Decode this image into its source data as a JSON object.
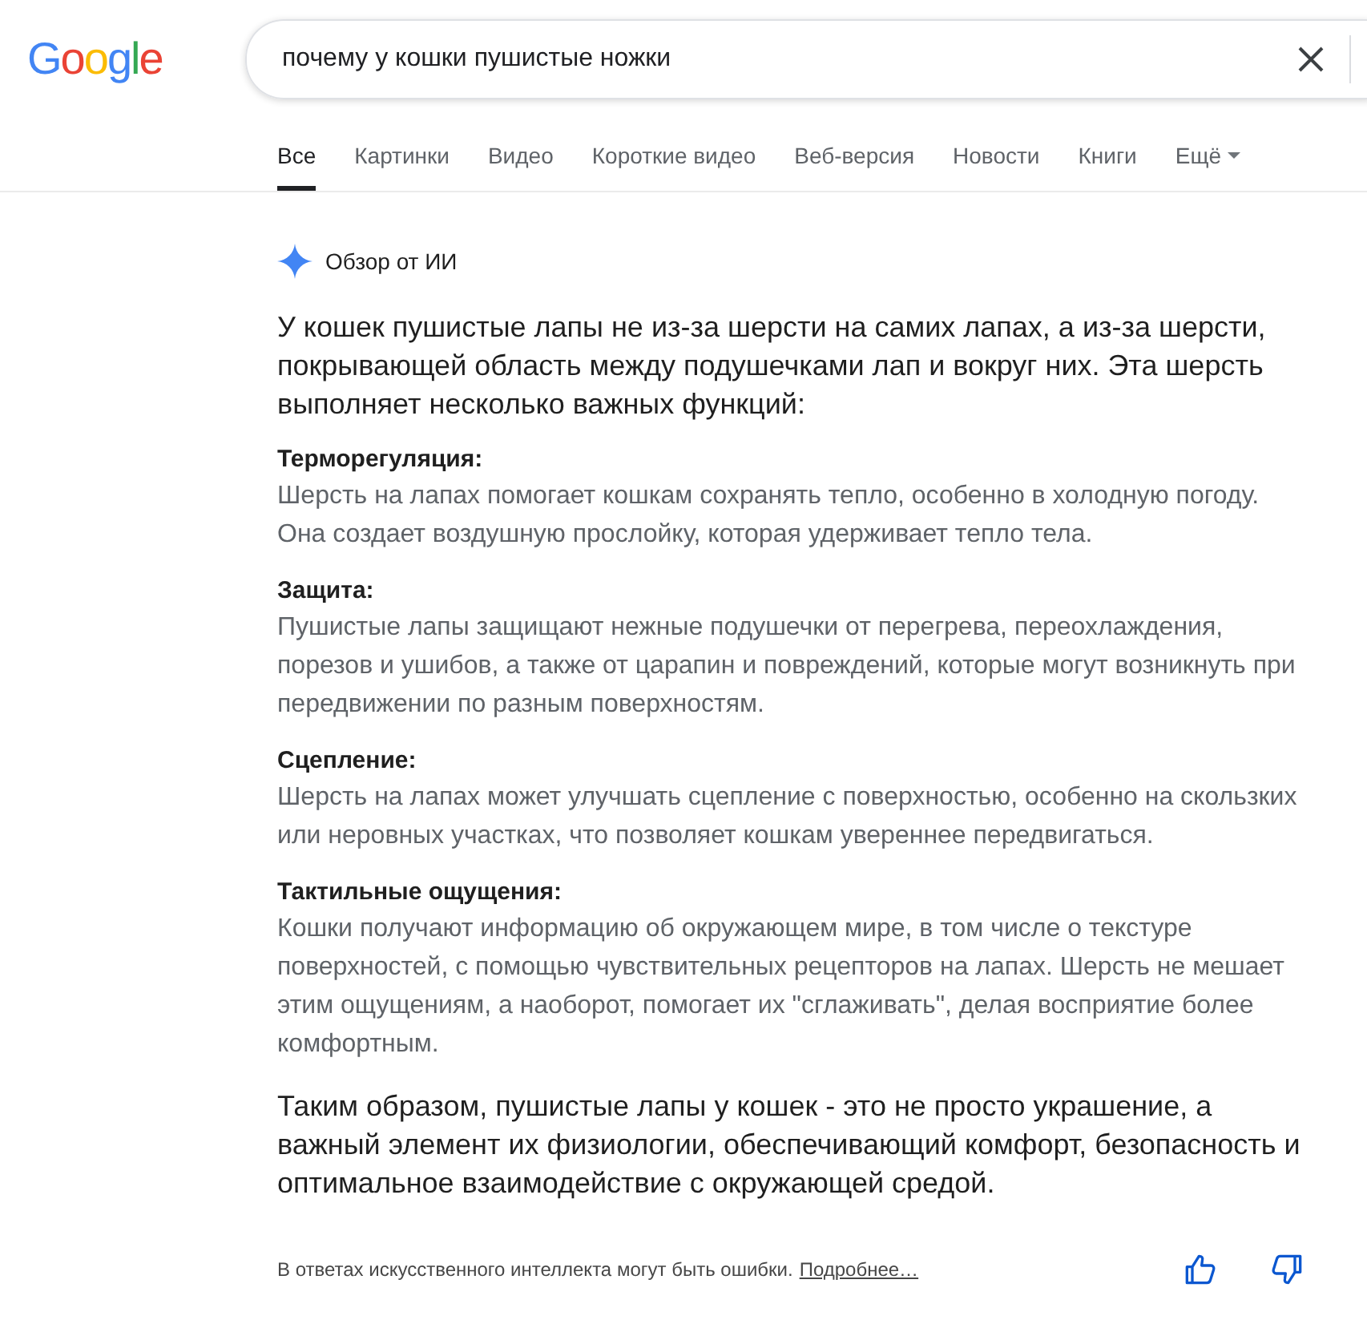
{
  "logo": "Google",
  "search": {
    "value": "почему у кошки пушистые ножки"
  },
  "tabs": [
    {
      "label": "Все",
      "selected": true
    },
    {
      "label": "Картинки",
      "selected": false
    },
    {
      "label": "Видео",
      "selected": false
    },
    {
      "label": "Короткие видео",
      "selected": false
    },
    {
      "label": "Веб-версия",
      "selected": false
    },
    {
      "label": "Новости",
      "selected": false
    },
    {
      "label": "Книги",
      "selected": false
    },
    {
      "label": "Ещё",
      "selected": false,
      "dropdown": true
    }
  ],
  "overview": {
    "title": "Обзор от ИИ",
    "intro": "У кошек пушистые лапы не из-за шерсти на самих лапах, а из-за шерсти, покрывающей область между подушечками лап и вокруг них. Эта шерсть выполняет несколько важных функций:",
    "sections": [
      {
        "heading": "Терморегуляция:",
        "text": "Шерсть на лапах помогает кошкам сохранять тепло, особенно в холодную погоду. Она создает воздушную прослойку, которая удерживает тепло тела."
      },
      {
        "heading": "Защита:",
        "text": "Пушистые лапы защищают нежные подушечки от перегрева, переохлаждения, порезов и ушибов, а также от царапин и повреждений, которые могут возникнуть при передвижении по разным поверхностям."
      },
      {
        "heading": "Сцепление:",
        "text": "Шерсть на лапах может улучшать сцепление с поверхностью, особенно на скользких или неровных участках, что позволяет кошкам увереннее передвигаться."
      },
      {
        "heading": "Тактильные ощущения:",
        "text": "Кошки получают информацию об окружающем мире, в том числе о текстуре поверхностей, с помощью чувствительных рецепторов на лапах. Шерсть не мешает этим ощущениям, а наоборот, помогает их \"сглаживать\", делая восприятие более комфортным."
      }
    ],
    "conclusion": "Таким образом, пушистые лапы у кошек - это не просто украшение, а важный элемент их физиологии, обеспечивающий комфорт, безопасность и оптимальное взаимодействие с окружающей средой.",
    "disclaimer": "В ответах искусственного интеллекта могут быть ошибки.",
    "link": "Подробнее…"
  }
}
